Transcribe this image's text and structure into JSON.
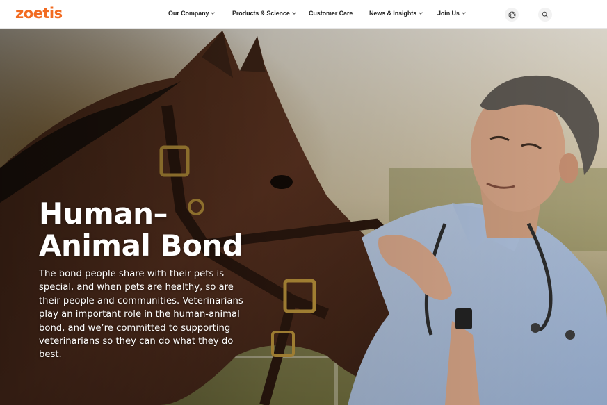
{
  "header": {
    "logo_text": "zoetis",
    "nav": [
      {
        "label": "Our Company",
        "has_dropdown": true
      },
      {
        "label": "Products & Science",
        "has_dropdown": true
      },
      {
        "label": "Customer Care",
        "has_dropdown": false
      },
      {
        "label": "News & Insights",
        "has_dropdown": true
      },
      {
        "label": "Join Us",
        "has_dropdown": true
      }
    ],
    "icons": {
      "language": "globe-icon",
      "search": "search-icon"
    }
  },
  "hero": {
    "title": "Human–Animal Bond",
    "body": "The bond people share with their pets is special, and when pets are healthy, so are their people and communities. Veterinarians play an important role in the human-animal bond, and we’re committed to supporting veterinarians so they can do what they do best."
  },
  "colors": {
    "brand": "#f26b21",
    "nav_text": "#222222",
    "hero_text": "#ffffff"
  }
}
